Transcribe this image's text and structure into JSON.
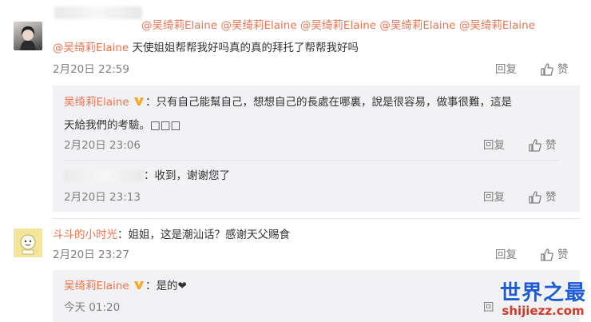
{
  "comment1": {
    "mentions_line1": "@吴绮莉Elaine @吴绮莉Elaine @吴绮莉Elaine @吴绮莉Elaine @吴绮莉Elaine",
    "mention_line2": "@吴绮莉Elaine",
    "text_line2": " 天使姐姐帮帮我好吗真的真的拜托了帮帮我好吗",
    "time": "2月20日 22:59",
    "reply_label": "回复",
    "like_label": "赞"
  },
  "reply1": {
    "author": "吴绮莉Elaine",
    "text_line1": "：只有自己能幫自己，想想自己的長處在哪裏，說是很容易，做事很難，這是",
    "text_line2": "天給我們的考驗。□□□",
    "time": "2月20日 23:06",
    "reply_label": "回复",
    "like_label": "赞"
  },
  "reply2": {
    "text": "：收到，谢谢您了",
    "time": "2月20日 23:13",
    "reply_label": "回复",
    "like_label": "赞"
  },
  "comment2": {
    "author": "斗斗的小时光",
    "text": "：姐姐，这是潮汕话？感谢天父赐食",
    "time": "2月20日 23:27",
    "reply_label": "回复",
    "like_label": "赞"
  },
  "reply3": {
    "author": "吴绮莉Elaine",
    "text": "：是的❤",
    "time": "今天 01:20",
    "reply_label": "回"
  },
  "watermark": {
    "title": "世界之最",
    "url": "shijiezz.com"
  },
  "colors": {
    "mention": "#eb7350",
    "meta": "#808080",
    "reply_bg": "#f2f2f5",
    "vip": "#f6a623"
  }
}
